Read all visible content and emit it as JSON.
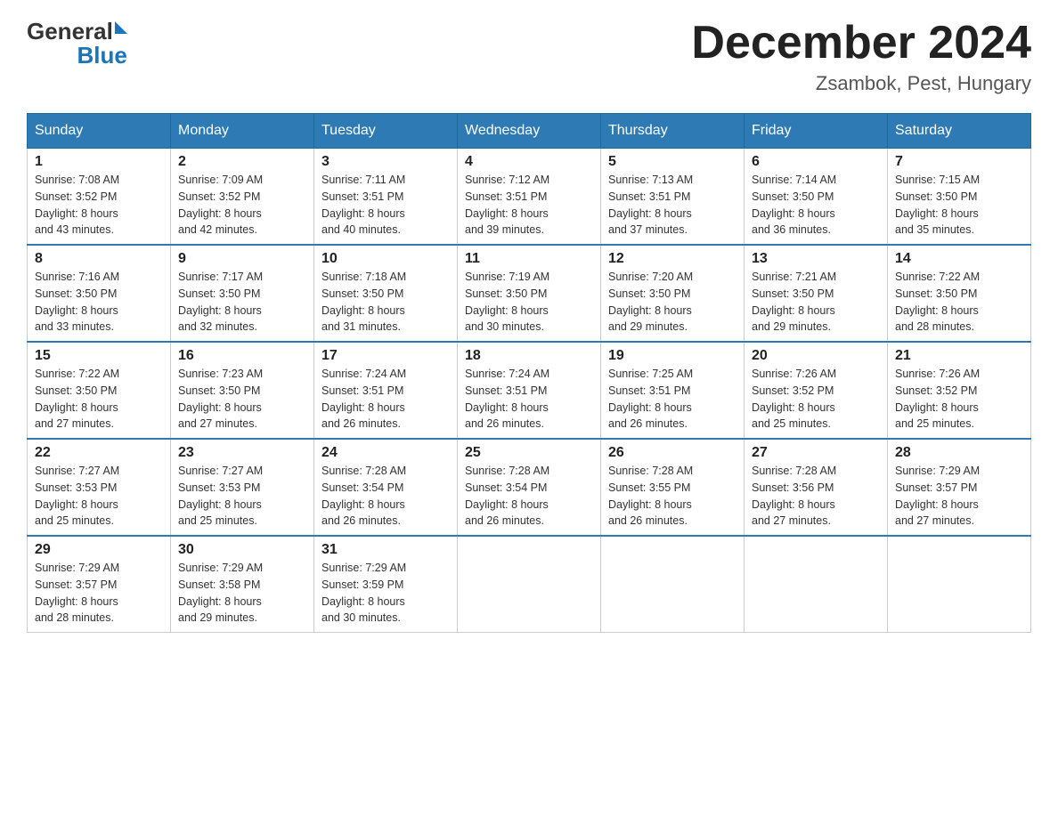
{
  "header": {
    "title": "December 2024",
    "subtitle": "Zsambok, Pest, Hungary",
    "logo_general": "General",
    "logo_blue": "Blue"
  },
  "days_of_week": [
    "Sunday",
    "Monday",
    "Tuesday",
    "Wednesday",
    "Thursday",
    "Friday",
    "Saturday"
  ],
  "weeks": [
    [
      {
        "day": "1",
        "sunrise": "7:08 AM",
        "sunset": "3:52 PM",
        "daylight": "8 hours and 43 minutes."
      },
      {
        "day": "2",
        "sunrise": "7:09 AM",
        "sunset": "3:52 PM",
        "daylight": "8 hours and 42 minutes."
      },
      {
        "day": "3",
        "sunrise": "7:11 AM",
        "sunset": "3:51 PM",
        "daylight": "8 hours and 40 minutes."
      },
      {
        "day": "4",
        "sunrise": "7:12 AM",
        "sunset": "3:51 PM",
        "daylight": "8 hours and 39 minutes."
      },
      {
        "day": "5",
        "sunrise": "7:13 AM",
        "sunset": "3:51 PM",
        "daylight": "8 hours and 37 minutes."
      },
      {
        "day": "6",
        "sunrise": "7:14 AM",
        "sunset": "3:50 PM",
        "daylight": "8 hours and 36 minutes."
      },
      {
        "day": "7",
        "sunrise": "7:15 AM",
        "sunset": "3:50 PM",
        "daylight": "8 hours and 35 minutes."
      }
    ],
    [
      {
        "day": "8",
        "sunrise": "7:16 AM",
        "sunset": "3:50 PM",
        "daylight": "8 hours and 33 minutes."
      },
      {
        "day": "9",
        "sunrise": "7:17 AM",
        "sunset": "3:50 PM",
        "daylight": "8 hours and 32 minutes."
      },
      {
        "day": "10",
        "sunrise": "7:18 AM",
        "sunset": "3:50 PM",
        "daylight": "8 hours and 31 minutes."
      },
      {
        "day": "11",
        "sunrise": "7:19 AM",
        "sunset": "3:50 PM",
        "daylight": "8 hours and 30 minutes."
      },
      {
        "day": "12",
        "sunrise": "7:20 AM",
        "sunset": "3:50 PM",
        "daylight": "8 hours and 29 minutes."
      },
      {
        "day": "13",
        "sunrise": "7:21 AM",
        "sunset": "3:50 PM",
        "daylight": "8 hours and 29 minutes."
      },
      {
        "day": "14",
        "sunrise": "7:22 AM",
        "sunset": "3:50 PM",
        "daylight": "8 hours and 28 minutes."
      }
    ],
    [
      {
        "day": "15",
        "sunrise": "7:22 AM",
        "sunset": "3:50 PM",
        "daylight": "8 hours and 27 minutes."
      },
      {
        "day": "16",
        "sunrise": "7:23 AM",
        "sunset": "3:50 PM",
        "daylight": "8 hours and 27 minutes."
      },
      {
        "day": "17",
        "sunrise": "7:24 AM",
        "sunset": "3:51 PM",
        "daylight": "8 hours and 26 minutes."
      },
      {
        "day": "18",
        "sunrise": "7:24 AM",
        "sunset": "3:51 PM",
        "daylight": "8 hours and 26 minutes."
      },
      {
        "day": "19",
        "sunrise": "7:25 AM",
        "sunset": "3:51 PM",
        "daylight": "8 hours and 26 minutes."
      },
      {
        "day": "20",
        "sunrise": "7:26 AM",
        "sunset": "3:52 PM",
        "daylight": "8 hours and 25 minutes."
      },
      {
        "day": "21",
        "sunrise": "7:26 AM",
        "sunset": "3:52 PM",
        "daylight": "8 hours and 25 minutes."
      }
    ],
    [
      {
        "day": "22",
        "sunrise": "7:27 AM",
        "sunset": "3:53 PM",
        "daylight": "8 hours and 25 minutes."
      },
      {
        "day": "23",
        "sunrise": "7:27 AM",
        "sunset": "3:53 PM",
        "daylight": "8 hours and 25 minutes."
      },
      {
        "day": "24",
        "sunrise": "7:28 AM",
        "sunset": "3:54 PM",
        "daylight": "8 hours and 26 minutes."
      },
      {
        "day": "25",
        "sunrise": "7:28 AM",
        "sunset": "3:54 PM",
        "daylight": "8 hours and 26 minutes."
      },
      {
        "day": "26",
        "sunrise": "7:28 AM",
        "sunset": "3:55 PM",
        "daylight": "8 hours and 26 minutes."
      },
      {
        "day": "27",
        "sunrise": "7:28 AM",
        "sunset": "3:56 PM",
        "daylight": "8 hours and 27 minutes."
      },
      {
        "day": "28",
        "sunrise": "7:29 AM",
        "sunset": "3:57 PM",
        "daylight": "8 hours and 27 minutes."
      }
    ],
    [
      {
        "day": "29",
        "sunrise": "7:29 AM",
        "sunset": "3:57 PM",
        "daylight": "8 hours and 28 minutes."
      },
      {
        "day": "30",
        "sunrise": "7:29 AM",
        "sunset": "3:58 PM",
        "daylight": "8 hours and 29 minutes."
      },
      {
        "day": "31",
        "sunrise": "7:29 AM",
        "sunset": "3:59 PM",
        "daylight": "8 hours and 30 minutes."
      },
      null,
      null,
      null,
      null
    ]
  ],
  "labels": {
    "sunrise": "Sunrise:",
    "sunset": "Sunset:",
    "daylight": "Daylight:"
  }
}
